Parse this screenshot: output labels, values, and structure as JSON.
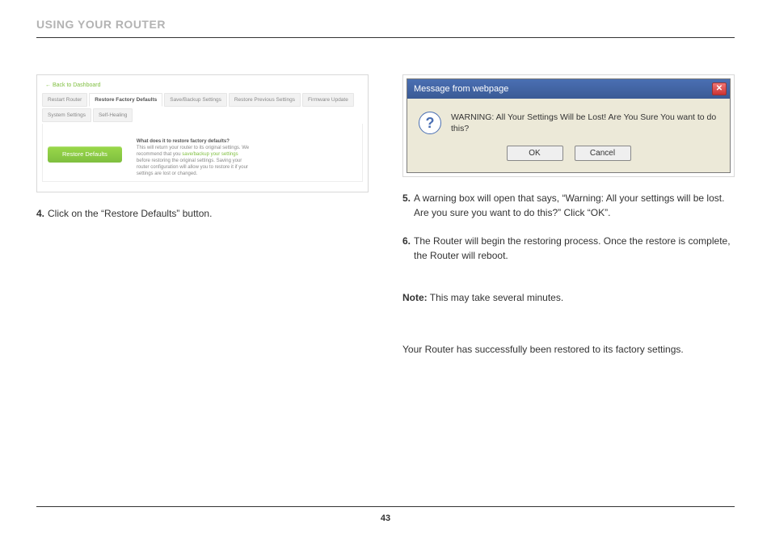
{
  "header": {
    "title": "USING YOUR ROUTER"
  },
  "router_panel": {
    "back": "← Back to Dashboard",
    "tabs": [
      "Restart Router",
      "Restore Factory Defaults",
      "Save/Backup Settings",
      "Restore Previous Settings",
      "Firmware Update",
      "System Settings",
      "Self-Healing"
    ],
    "button": "Restore Defaults",
    "info": {
      "q": "What does it to restore factory defaults?",
      "l1": "This will return your router to its original settings. We recommend that you ",
      "link": "save/backup your settings",
      "l2": " before restoring the original settings. Saving your router configuration will allow you to restore it if your settings are lost or changed."
    }
  },
  "dialog": {
    "title": "Message from webpage",
    "close": "✕",
    "icon": "?",
    "message": "WARNING: All Your Settings Will be Lost! Are You Sure You want to do this?",
    "ok": "OK",
    "cancel": "Cancel"
  },
  "steps": {
    "s4_num": "4.",
    "s4_txt": "Click on the “Restore Defaults” button.",
    "s5_num": "5.",
    "s5_txt": "A warning box will open that says, “Warning: All your settings will be lost. Are you sure you want to do this?” Click “OK”.",
    "s6_num": "6.",
    "s6_txt": "The Router will begin the restoring process. Once the restore is complete, the Router will reboot."
  },
  "note": {
    "label": "Note:",
    "text": " This may take several minutes."
  },
  "final": "Your Router has successfully been restored to its factory settings.",
  "page_number": "43"
}
